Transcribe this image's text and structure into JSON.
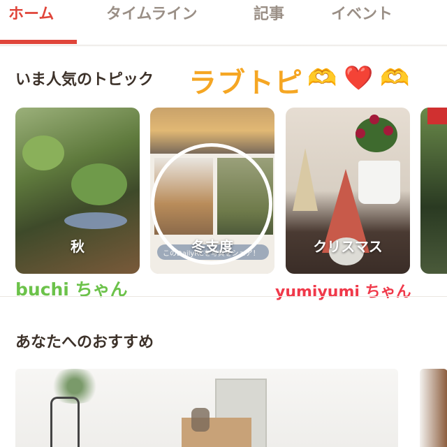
{
  "tabs": [
    {
      "label": "ホーム",
      "active": true
    },
    {
      "label": "タイムライン",
      "active": false
    },
    {
      "label": "記事",
      "active": false
    },
    {
      "label": "イベント",
      "active": false
    }
  ],
  "popular": {
    "title": "いま人気のトピック",
    "overlay_caption": "ラブトピ",
    "overlay_emojis": [
      "🫶",
      "❤️",
      "🫶"
    ],
    "cards": [
      {
        "label": "秋"
      },
      {
        "label": "冬支度",
        "photo_text": "このDailyRCを写真をシェア！"
      },
      {
        "label": "クリスマス"
      },
      {
        "label": ""
      }
    ],
    "credits": {
      "left": "buchi ちゃん",
      "right": "yumiyumi ちゃん"
    }
  },
  "recommend": {
    "title": "あなたへのおすすめ"
  },
  "colors": {
    "accent": "#e0453a",
    "tab_inactive": "#9a8f86",
    "title_text": "#3c3129",
    "overlay_caption": "#f5a623",
    "credit_left": "#6cc24a",
    "credit_right": "#f0394a"
  }
}
